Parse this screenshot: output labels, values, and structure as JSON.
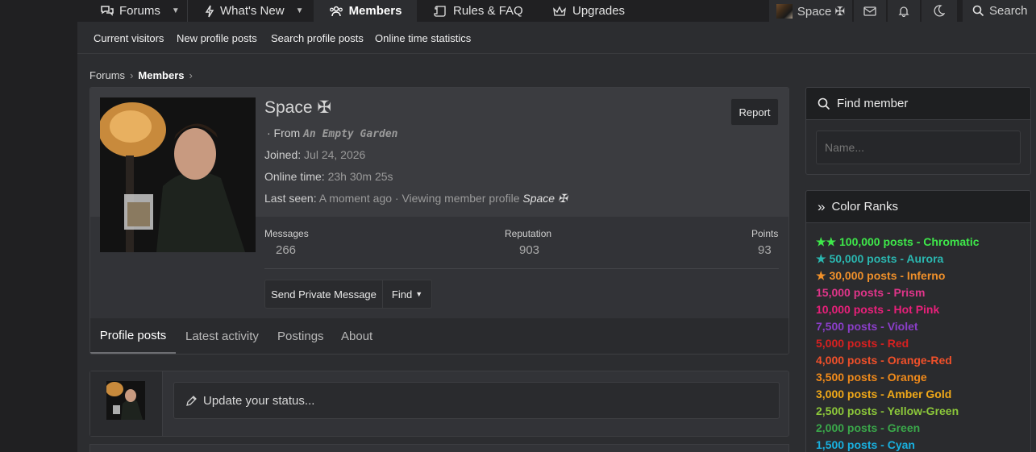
{
  "nav": {
    "forums": "Forums",
    "whats_new": "What's New",
    "members": "Members",
    "rules": "Rules & FAQ",
    "upgrades": "Upgrades",
    "user": "Space ✠",
    "search": "Search"
  },
  "subnav": [
    "Current visitors",
    "New profile posts",
    "Search profile posts",
    "Online time statistics"
  ],
  "breadcrumb": {
    "forums": "Forums",
    "members": "Members"
  },
  "profile": {
    "name": "Space ✠",
    "from_label": "· From",
    "from_value": "An Empty Garden",
    "joined_label": "Joined:",
    "joined_value": "Jul 24, 2026",
    "online_label": "Online time:",
    "online_value": "23h 30m 25s",
    "seen_label": "Last seen:",
    "seen_value": "A moment ago · Viewing member profile",
    "seen_target": "Space ✠",
    "report": "Report",
    "stats": {
      "messages_label": "Messages",
      "messages_value": "266",
      "reputation_label": "Reputation",
      "reputation_value": "903",
      "points_label": "Points",
      "points_value": "93"
    },
    "send_pm": "Send Private Message",
    "find": "Find",
    "tabs": [
      "Profile posts",
      "Latest activity",
      "Postings",
      "About"
    ]
  },
  "status": {
    "placeholder": "Update your status..."
  },
  "sidebar": {
    "find_member": {
      "title": "Find member",
      "placeholder": "Name..."
    },
    "color_ranks": {
      "title": "Color Ranks",
      "items": [
        {
          "text": "★★ 100,000 posts - Chromatic",
          "color": "#3ee84a"
        },
        {
          "text": "★ 50,000 posts - Aurora",
          "color": "#2ab7b0"
        },
        {
          "text": "★ 30,000 posts - Inferno",
          "color": "#f0902a"
        },
        {
          "text": "15,000 posts - Prism",
          "color": "#e0358a"
        },
        {
          "text": "10,000 posts - Hot Pink",
          "color": "#e8207a"
        },
        {
          "text": "7,500 posts - Violet",
          "color": "#8a3ec8"
        },
        {
          "text": "5,000 posts - Red",
          "color": "#d82020"
        },
        {
          "text": "4,000 posts - Orange-Red",
          "color": "#f0502a"
        },
        {
          "text": "3,500 posts - Orange",
          "color": "#f08a1a"
        },
        {
          "text": "3,000 posts - Amber Gold",
          "color": "#f0a818"
        },
        {
          "text": "2,500 posts - Yellow-Green",
          "color": "#8cc83a"
        },
        {
          "text": "2,000 posts - Green",
          "color": "#3aa84a"
        },
        {
          "text": "1,500 posts - Cyan",
          "color": "#18b0e0"
        }
      ]
    }
  }
}
